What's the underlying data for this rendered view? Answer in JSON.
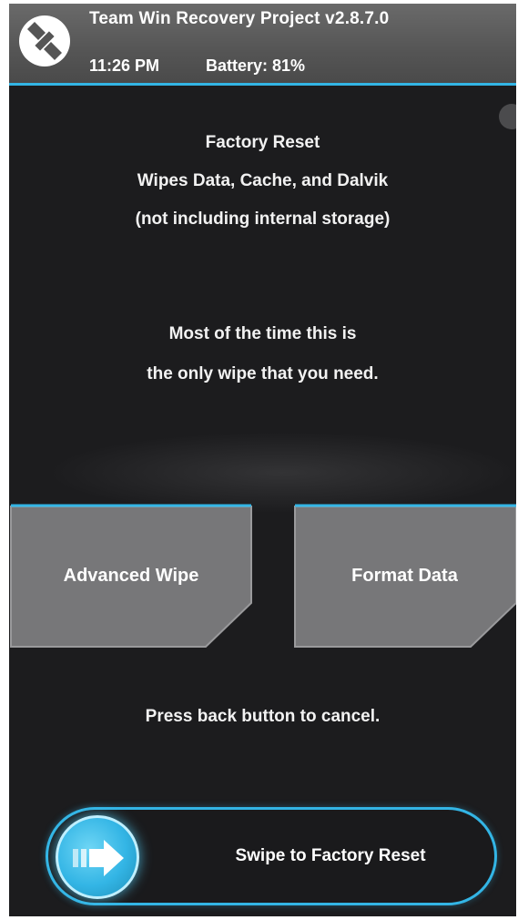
{
  "header": {
    "title": "Team Win Recovery Project  v2.8.7.0",
    "time": "11:26 PM",
    "battery": "Battery: 81%",
    "logo_icon": "twrp-logo-icon",
    "accent_color": "#33b5e5"
  },
  "info": {
    "line1": "Factory Reset",
    "line2": "Wipes Data, Cache, and Dalvik",
    "line3": "(not including internal storage)",
    "line4": "Most of the time this is",
    "line5": "the only wipe that you need."
  },
  "buttons": {
    "advanced_wipe": "Advanced Wipe",
    "format_data": "Format Data"
  },
  "cancel_hint": "Press back button to cancel.",
  "slider": {
    "label": "Swipe to Factory Reset",
    "handle_icon": "arrow-right-icon",
    "progress": 0
  }
}
